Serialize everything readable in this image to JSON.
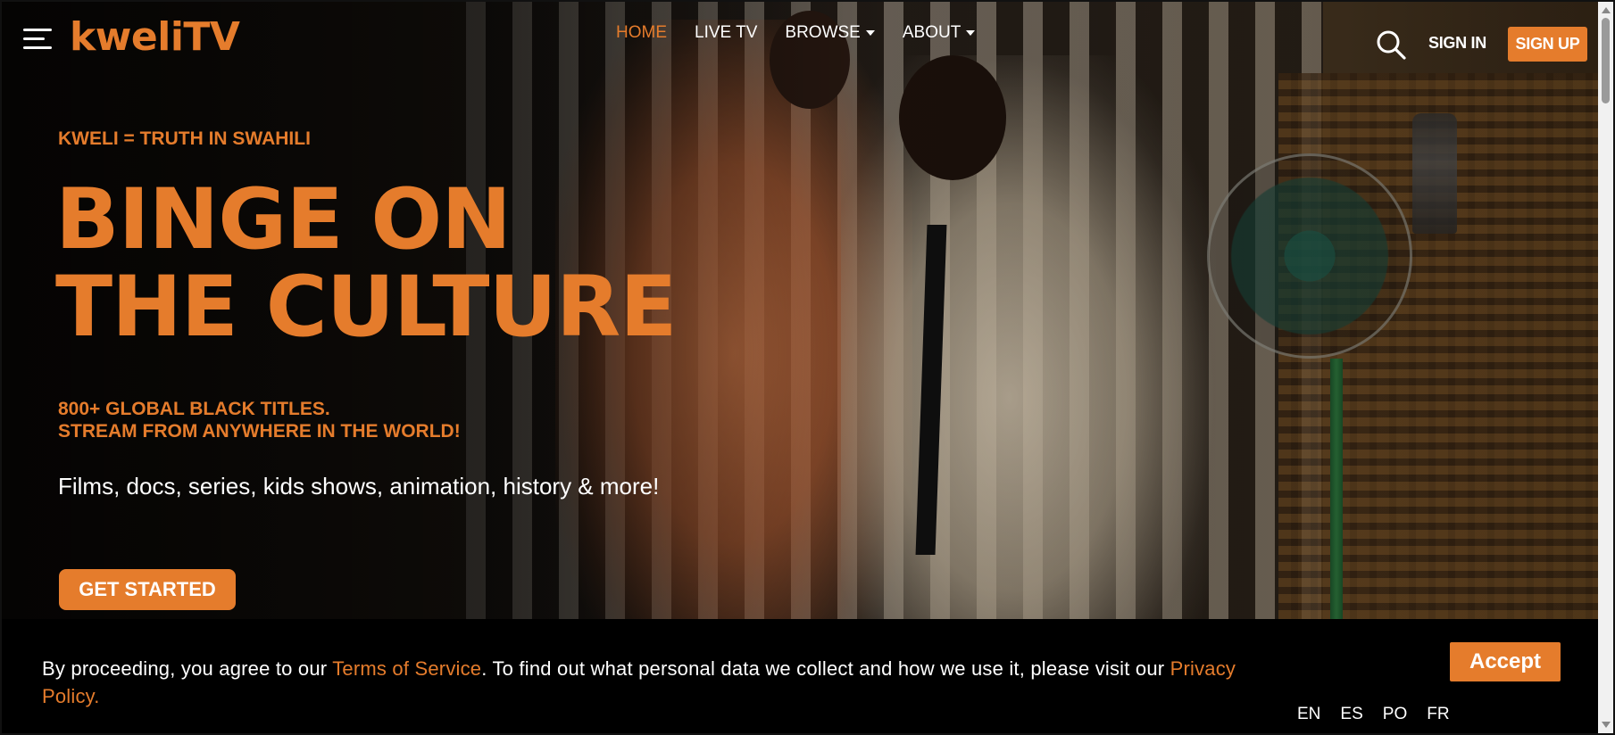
{
  "brand": {
    "logo_text": "kweliTV",
    "accent_color": "#e57c2c"
  },
  "nav": {
    "menu_icon": "hamburger-menu-icon",
    "links": [
      {
        "label": "HOME",
        "active": true,
        "dropdown": false
      },
      {
        "label": "LIVE TV",
        "active": false,
        "dropdown": false
      },
      {
        "label": "BROWSE",
        "active": false,
        "dropdown": true
      },
      {
        "label": "ABOUT",
        "active": false,
        "dropdown": true
      }
    ],
    "search_icon": "search-icon",
    "sign_in": "SIGN IN",
    "sign_up": "SIGN UP"
  },
  "hero": {
    "tagline": "KWELI = TRUTH IN SWAHILI",
    "headline_line1": "BINGE ON",
    "headline_line2": "THE CULTURE",
    "sub_line1": "800+ GLOBAL BLACK TITLES.",
    "sub_line2": "STREAM FROM ANYWHERE IN THE WORLD!",
    "description": "Films, docs, series, kids shows, animation, history & more!",
    "cta": "GET STARTED"
  },
  "cookie_bar": {
    "text_before": "By proceeding, you agree to our ",
    "terms_link": "Terms of Service",
    "text_middle": ". To find out what personal data we collect and how we use it, please visit our ",
    "privacy_link": "Privacy Policy",
    "text_after": ".",
    "accept": "Accept",
    "languages": [
      "EN",
      "ES",
      "PO",
      "FR"
    ]
  }
}
